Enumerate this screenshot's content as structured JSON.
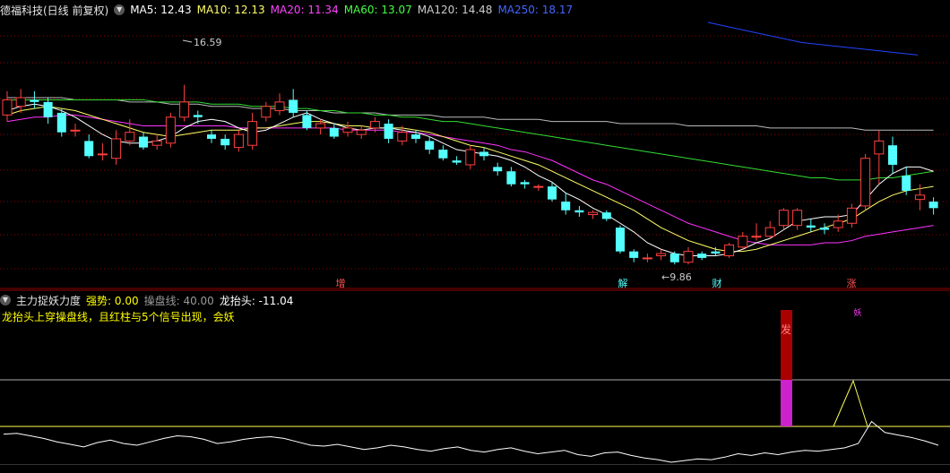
{
  "main_header": {
    "title": "德福科技(日线 前复权)",
    "mas": [
      {
        "label": "MA5: 12.43",
        "color": "#ffffff"
      },
      {
        "label": "MA10: 12.13",
        "color": "#ffff66"
      },
      {
        "label": "MA20: 11.34",
        "color": "#ff44ff"
      },
      {
        "label": "MA60: 13.07",
        "color": "#44ff44"
      },
      {
        "label": "MA120: 14.48",
        "color": "#cccccc"
      },
      {
        "label": "MA250: 18.17",
        "color": "#4466ff"
      }
    ]
  },
  "price_annotations": {
    "high_label": "16.59",
    "low_label": "9.86",
    "markers": [
      "增",
      "解",
      "财",
      "涨"
    ]
  },
  "sub_header": {
    "title": "主力捉妖力度",
    "strength_label": "强势: 0.00",
    "operate_label": "操盘线: 40.00",
    "dragon_label": "龙抬头: -11.04",
    "note": "龙抬头上穿操盘线，且红柱与5个信号出现，会妖",
    "signal_text": "发",
    "signal_text2": "妖"
  },
  "chart_data": {
    "type": "candlestick",
    "candles": [
      {
        "o": 15.2,
        "c": 15.9,
        "h": 16.3,
        "l": 14.9
      },
      {
        "o": 15.6,
        "c": 16.0,
        "h": 16.4,
        "l": 15.3
      },
      {
        "o": 15.9,
        "c": 15.8,
        "h": 16.3,
        "l": 15.5
      },
      {
        "o": 15.8,
        "c": 15.1,
        "h": 16.0,
        "l": 14.8
      },
      {
        "o": 15.3,
        "c": 14.4,
        "h": 15.5,
        "l": 14.2
      },
      {
        "o": 14.5,
        "c": 14.5,
        "h": 14.8,
        "l": 14.2
      },
      {
        "o": 14.0,
        "c": 13.3,
        "h": 14.3,
        "l": 13.2
      },
      {
        "o": 13.4,
        "c": 13.4,
        "h": 13.9,
        "l": 13.1
      },
      {
        "o": 13.2,
        "c": 14.1,
        "h": 14.5,
        "l": 12.9
      },
      {
        "o": 14.0,
        "c": 14.4,
        "h": 15.0,
        "l": 13.8
      },
      {
        "o": 14.2,
        "c": 13.7,
        "h": 14.4,
        "l": 13.6
      },
      {
        "o": 13.8,
        "c": 14.0,
        "h": 14.3,
        "l": 13.6
      },
      {
        "o": 13.9,
        "c": 15.1,
        "h": 15.3,
        "l": 13.7
      },
      {
        "o": 15.1,
        "c": 15.8,
        "h": 16.59,
        "l": 14.9
      },
      {
        "o": 15.2,
        "c": 15.1,
        "h": 15.4,
        "l": 14.8
      },
      {
        "o": 14.3,
        "c": 14.1,
        "h": 14.5,
        "l": 13.9
      },
      {
        "o": 14.1,
        "c": 13.8,
        "h": 14.3,
        "l": 13.6
      },
      {
        "o": 13.7,
        "c": 14.3,
        "h": 14.5,
        "l": 13.5
      },
      {
        "o": 13.8,
        "c": 14.9,
        "h": 15.3,
        "l": 13.6
      },
      {
        "o": 15.1,
        "c": 15.6,
        "h": 15.8,
        "l": 14.9
      },
      {
        "o": 15.4,
        "c": 15.8,
        "h": 16.2,
        "l": 15.2
      },
      {
        "o": 15.9,
        "c": 15.3,
        "h": 16.4,
        "l": 15.1
      },
      {
        "o": 15.2,
        "c": 14.6,
        "h": 15.4,
        "l": 14.5
      },
      {
        "o": 14.6,
        "c": 14.8,
        "h": 15.0,
        "l": 14.3
      },
      {
        "o": 14.6,
        "c": 14.2,
        "h": 14.8,
        "l": 14.1
      },
      {
        "o": 14.4,
        "c": 14.6,
        "h": 14.9,
        "l": 14.2
      },
      {
        "o": 14.3,
        "c": 14.5,
        "h": 14.7,
        "l": 14.1
      },
      {
        "o": 14.6,
        "c": 14.9,
        "h": 15.1,
        "l": 14.4
      },
      {
        "o": 14.8,
        "c": 14.1,
        "h": 15.0,
        "l": 13.9
      },
      {
        "o": 14.0,
        "c": 14.4,
        "h": 14.7,
        "l": 13.8
      },
      {
        "o": 14.3,
        "c": 14.1,
        "h": 14.5,
        "l": 13.9
      },
      {
        "o": 14.0,
        "c": 13.6,
        "h": 14.2,
        "l": 13.4
      },
      {
        "o": 13.6,
        "c": 13.2,
        "h": 13.8,
        "l": 13.1
      },
      {
        "o": 13.1,
        "c": 13.0,
        "h": 13.3,
        "l": 12.9
      },
      {
        "o": 12.9,
        "c": 13.6,
        "h": 13.8,
        "l": 12.7
      },
      {
        "o": 13.5,
        "c": 13.3,
        "h": 13.7,
        "l": 13.1
      },
      {
        "o": 12.8,
        "c": 12.6,
        "h": 13.0,
        "l": 12.4
      },
      {
        "o": 12.6,
        "c": 12.0,
        "h": 12.8,
        "l": 11.9
      },
      {
        "o": 12.1,
        "c": 12.0,
        "h": 12.2,
        "l": 11.8
      },
      {
        "o": 11.9,
        "c": 11.9,
        "h": 12.0,
        "l": 11.7
      },
      {
        "o": 11.9,
        "c": 11.3,
        "h": 12.1,
        "l": 11.2
      },
      {
        "o": 11.2,
        "c": 10.8,
        "h": 11.6,
        "l": 10.6
      },
      {
        "o": 10.8,
        "c": 10.7,
        "h": 11.0,
        "l": 10.5
      },
      {
        "o": 10.6,
        "c": 10.7,
        "h": 10.8,
        "l": 10.4
      },
      {
        "o": 10.7,
        "c": 10.4,
        "h": 10.8,
        "l": 10.3
      },
      {
        "o": 10.0,
        "c": 8.9,
        "h": 10.1,
        "l": 8.8
      },
      {
        "o": 8.9,
        "c": 8.6,
        "h": 9.0,
        "l": 8.4
      },
      {
        "o": 8.6,
        "c": 8.6,
        "h": 8.8,
        "l": 8.4
      },
      {
        "o": 8.7,
        "c": 8.8,
        "h": 9.0,
        "l": 8.5
      },
      {
        "o": 8.8,
        "c": 8.4,
        "h": 8.9,
        "l": 8.3
      },
      {
        "o": 8.4,
        "c": 8.9,
        "h": 9.1,
        "l": 8.3
      },
      {
        "o": 8.8,
        "c": 8.6,
        "h": 8.9,
        "l": 8.5
      },
      {
        "o": 8.9,
        "c": 8.8,
        "h": 9.1,
        "l": 8.7
      },
      {
        "o": 8.7,
        "c": 9.2,
        "h": 9.3,
        "l": 8.6
      },
      {
        "o": 9.1,
        "c": 9.6,
        "h": 9.8,
        "l": 9.0
      },
      {
        "o": 9.6,
        "c": 9.6,
        "h": 10.2,
        "l": 9.4
      },
      {
        "o": 9.6,
        "c": 10.0,
        "h": 10.3,
        "l": 9.5
      },
      {
        "o": 10.1,
        "c": 10.8,
        "h": 10.9,
        "l": 9.9
      },
      {
        "o": 10.1,
        "c": 10.8,
        "h": 10.9,
        "l": 9.9
      },
      {
        "o": 10.1,
        "c": 10.0,
        "h": 10.4,
        "l": 9.8
      },
      {
        "o": 10.0,
        "c": 9.9,
        "h": 10.2,
        "l": 9.7
      },
      {
        "o": 10.0,
        "c": 10.3,
        "h": 10.6,
        "l": 9.8
      },
      {
        "o": 10.2,
        "c": 10.9,
        "h": 11.1,
        "l": 10.0
      },
      {
        "o": 11.0,
        "c": 13.2,
        "h": 13.4,
        "l": 10.8
      },
      {
        "o": 13.4,
        "c": 14.0,
        "h": 14.5,
        "l": 12.0
      },
      {
        "o": 13.8,
        "c": 12.9,
        "h": 14.2,
        "l": 12.5
      },
      {
        "o": 12.4,
        "c": 11.7,
        "h": 12.8,
        "l": 11.5
      },
      {
        "o": 11.3,
        "c": 11.5,
        "h": 12.0,
        "l": 10.8
      },
      {
        "o": 11.2,
        "c": 10.9,
        "h": 11.4,
        "l": 10.6
      }
    ],
    "ma5": [
      15.4,
      15.6,
      15.7,
      15.6,
      15.4,
      15.1,
      14.7,
      14.3,
      14.0,
      13.9,
      13.9,
      14.0,
      14.2,
      14.6,
      14.9,
      15.0,
      14.9,
      14.6,
      14.4,
      14.5,
      14.8,
      15.1,
      15.3,
      15.0,
      14.8,
      14.6,
      14.5,
      14.6,
      14.6,
      14.5,
      14.4,
      14.2,
      13.9,
      13.6,
      13.5,
      13.4,
      13.3,
      13.1,
      12.8,
      12.4,
      12.1,
      11.6,
      11.3,
      10.9,
      10.6,
      10.2,
      9.8,
      9.3,
      9.0,
      8.8,
      8.7,
      8.7,
      8.7,
      8.8,
      9.0,
      9.3,
      9.5,
      9.9,
      10.3,
      10.4,
      10.5,
      10.5,
      10.6,
      11.3,
      12.0,
      12.5,
      12.8,
      12.8,
      12.6
    ],
    "ma10": [
      15.2,
      15.4,
      15.5,
      15.6,
      15.5,
      15.4,
      15.2,
      15.0,
      14.8,
      14.6,
      14.4,
      14.3,
      14.2,
      14.3,
      14.4,
      14.5,
      14.5,
      14.5,
      14.6,
      14.6,
      14.7,
      14.8,
      14.9,
      14.9,
      14.8,
      14.7,
      14.7,
      14.6,
      14.6,
      14.6,
      14.5,
      14.4,
      14.2,
      14.0,
      13.8,
      13.7,
      13.5,
      13.3,
      13.1,
      12.9,
      12.6,
      12.3,
      12.0,
      11.7,
      11.4,
      11.1,
      10.8,
      10.4,
      10.0,
      9.7,
      9.4,
      9.2,
      9.0,
      8.9,
      8.9,
      9.0,
      9.2,
      9.4,
      9.6,
      9.8,
      10.0,
      10.2,
      10.4,
      10.8,
      11.2,
      11.5,
      11.7,
      11.8,
      11.9
    ],
    "ma20": [
      14.9,
      15.0,
      15.1,
      15.1,
      15.2,
      15.2,
      15.1,
      15.0,
      14.9,
      14.8,
      14.7,
      14.7,
      14.7,
      14.7,
      14.7,
      14.7,
      14.7,
      14.6,
      14.6,
      14.6,
      14.6,
      14.6,
      14.6,
      14.6,
      14.6,
      14.5,
      14.5,
      14.5,
      14.5,
      14.4,
      14.4,
      14.3,
      14.2,
      14.1,
      14.0,
      13.9,
      13.8,
      13.6,
      13.5,
      13.3,
      13.1,
      12.8,
      12.5,
      12.2,
      12.0,
      11.7,
      11.4,
      11.1,
      10.8,
      10.5,
      10.2,
      10.0,
      9.8,
      9.6,
      9.4,
      9.3,
      9.2,
      9.2,
      9.2,
      9.2,
      9.3,
      9.3,
      9.4,
      9.6,
      9.7,
      9.8,
      9.9,
      10.0,
      10.1
    ],
    "ma60": [
      15.9,
      15.9,
      15.9,
      15.9,
      15.9,
      15.9,
      15.9,
      15.9,
      15.9,
      15.9,
      15.9,
      15.8,
      15.8,
      15.8,
      15.8,
      15.7,
      15.7,
      15.7,
      15.6,
      15.6,
      15.6,
      15.5,
      15.5,
      15.4,
      15.4,
      15.3,
      15.3,
      15.2,
      15.2,
      15.1,
      15.1,
      15.0,
      14.9,
      14.9,
      14.8,
      14.7,
      14.6,
      14.5,
      14.4,
      14.3,
      14.2,
      14.1,
      14.0,
      13.9,
      13.8,
      13.7,
      13.6,
      13.5,
      13.4,
      13.3,
      13.2,
      13.1,
      13.0,
      12.9,
      12.8,
      12.7,
      12.6,
      12.5,
      12.4,
      12.3,
      12.3,
      12.2,
      12.2,
      12.2,
      12.3,
      12.3,
      12.4,
      12.5,
      12.6
    ],
    "ma120": [
      16.0,
      16.0,
      16.0,
      16.0,
      16.0,
      15.9,
      15.9,
      15.9,
      15.9,
      15.8,
      15.8,
      15.8,
      15.7,
      15.7,
      15.7,
      15.6,
      15.6,
      15.6,
      15.5,
      15.5,
      15.5,
      15.4,
      15.4,
      15.4,
      15.3,
      15.3,
      15.3,
      15.3,
      15.2,
      15.2,
      15.2,
      15.2,
      15.1,
      15.1,
      15.1,
      15.1,
      15.0,
      15.0,
      15.0,
      15.0,
      14.9,
      14.9,
      14.9,
      14.9,
      14.9,
      14.8,
      14.8,
      14.8,
      14.8,
      14.8,
      14.7,
      14.7,
      14.7,
      14.7,
      14.7,
      14.7,
      14.6,
      14.6,
      14.6,
      14.6,
      14.6,
      14.6,
      14.6,
      14.5,
      14.5,
      14.5,
      14.5,
      14.5,
      14.5
    ],
    "ma250_segment": [
      19.4,
      19.2,
      19.0,
      18.8,
      18.6,
      18.5,
      18.4,
      18.3,
      18.2,
      18.1
    ],
    "indicator": {
      "operate_level": 40,
      "dragon": [
        33,
        34,
        31,
        28,
        24,
        21,
        18,
        23,
        26,
        22,
        20,
        24,
        28,
        31,
        30,
        27,
        22,
        24,
        27,
        29,
        30,
        28,
        24,
        20,
        19,
        21,
        18,
        15,
        17,
        20,
        18,
        15,
        13,
        16,
        18,
        14,
        12,
        15,
        17,
        13,
        10,
        12,
        14,
        9,
        7,
        11,
        12,
        8,
        5,
        3,
        0,
        2,
        4,
        3,
        6,
        10,
        8,
        11,
        9,
        12,
        14,
        13,
        15,
        17,
        22,
        60,
        35,
        32,
        29,
        25,
        20
      ],
      "signal_bars": [
        {
          "index": 63,
          "top_red_value": 106,
          "pink_from": 75
        }
      ],
      "spike_index": 65
    }
  }
}
